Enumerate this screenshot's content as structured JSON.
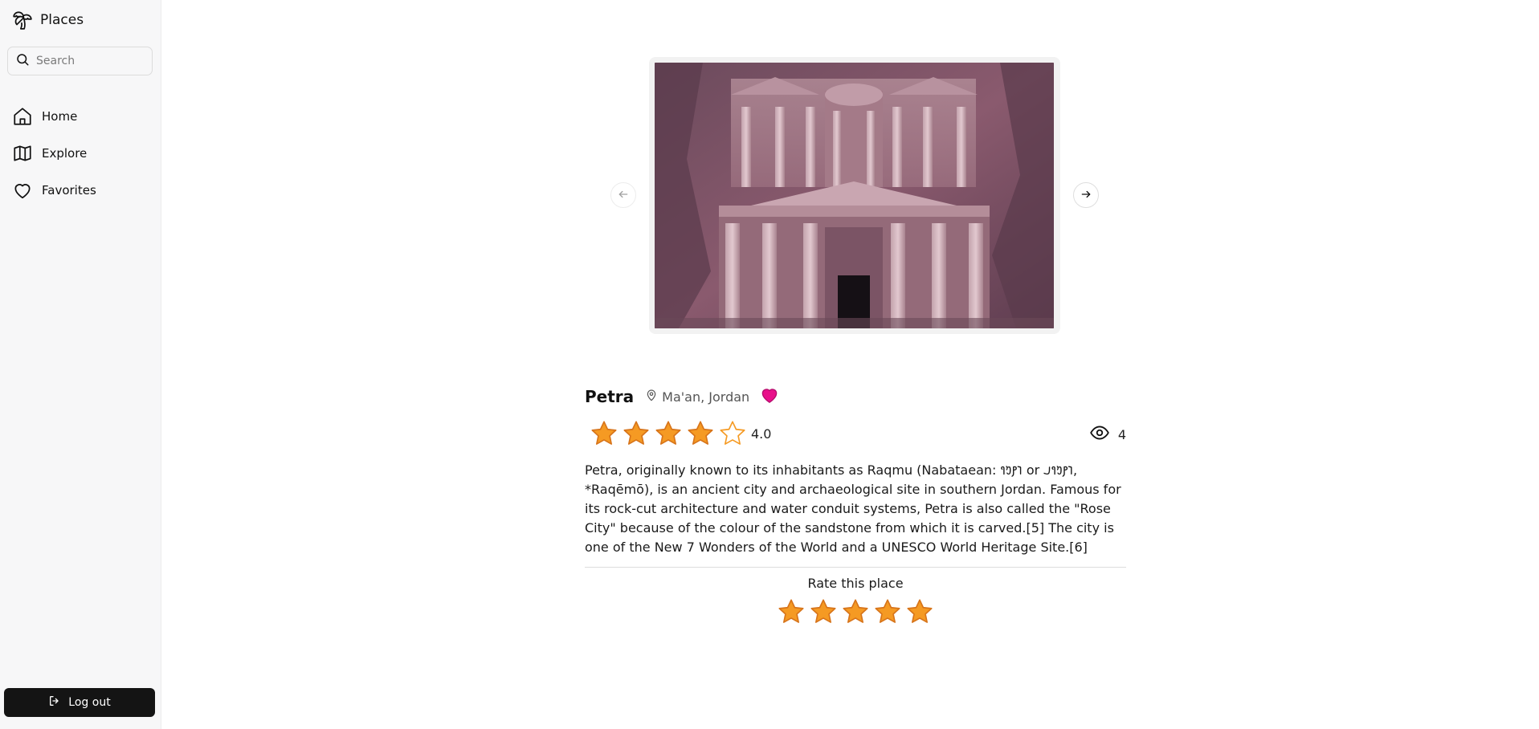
{
  "app": {
    "title": "Places"
  },
  "sidebar": {
    "search_placeholder": "Search",
    "nav": [
      {
        "label": "Home",
        "icon": "home-icon"
      },
      {
        "label": "Explore",
        "icon": "map-icon"
      },
      {
        "label": "Favorites",
        "icon": "heart-icon"
      }
    ],
    "logout_label": "Log out"
  },
  "place": {
    "name": "Petra",
    "location": "Ma'an, Jordan",
    "favorited": true,
    "rating_value": "4.0",
    "rating_stars_filled": 4,
    "rating_stars_total": 5,
    "views": "4",
    "description": "Petra, originally known to its inhabitants as Raqmu (Nabataean: 𐢛𐢚𐢓𐢈 or 𐢛𐢚𐢓𐢈𐢃, *Raqēmō), is an ancient city and archaeological site in southern Jordan. Famous for its rock-cut architecture and water conduit systems, Petra is also called the \"Rose City\" because of the colour of the sandstone from which it is carved.[5] The city is one of the New 7 Wonders of the World and a UNESCO World Heritage Site.[6]"
  },
  "rate": {
    "title": "Rate this place",
    "stars": 5
  },
  "colors": {
    "star": "#f59a23",
    "star_stroke": "#d7741a",
    "favorite": "#e8108a",
    "logout_bg": "#141414"
  }
}
